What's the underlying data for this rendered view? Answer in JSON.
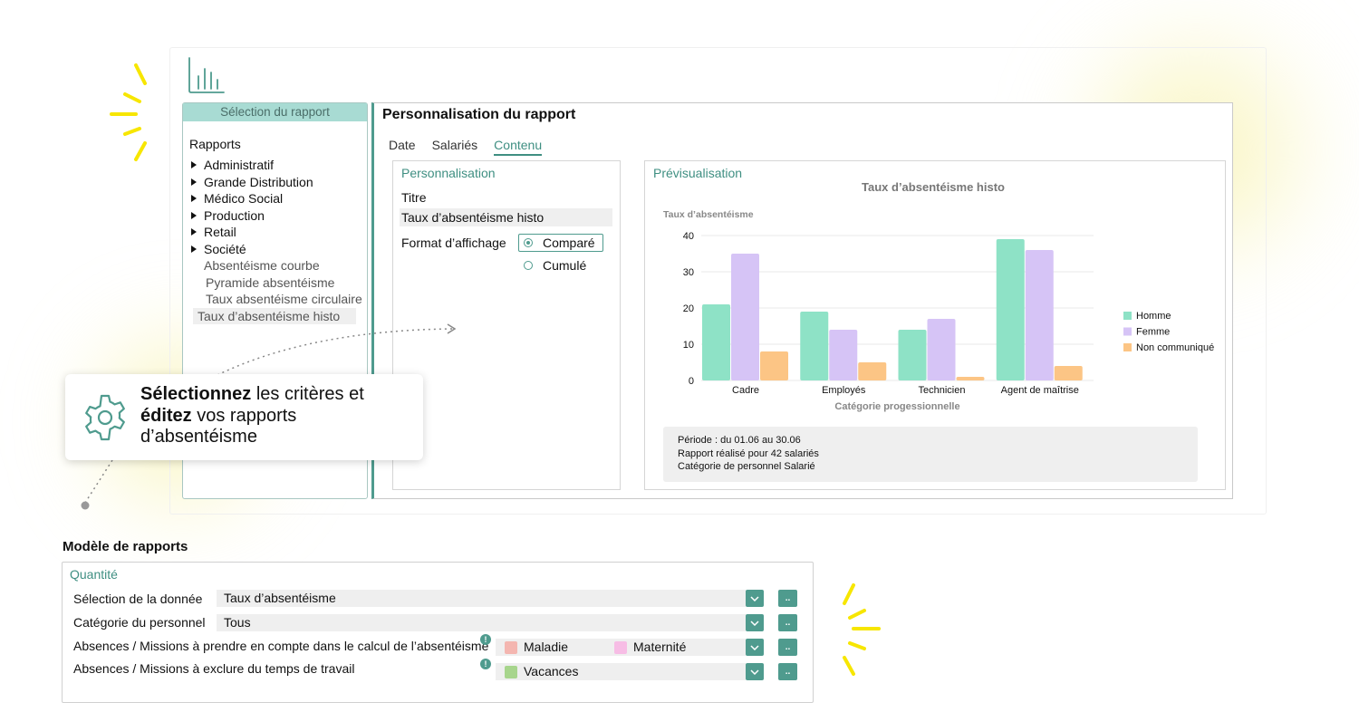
{
  "sidebar": {
    "header": "Sélection du rapport",
    "section": "Rapports",
    "folders": [
      "Administratif",
      "Grande Distribution",
      "Médico Social",
      "Production",
      "Retail",
      "Société"
    ],
    "reports": [
      "Absentéisme courbe",
      "Pyramide absentéisme",
      "Taux absentéisme circulaire",
      "Taux d’absentéisme histo"
    ]
  },
  "main": {
    "title": "Personnalisation du rapport",
    "tabs": [
      "Date",
      "Salariés",
      "Contenu"
    ],
    "active_tab": "Contenu",
    "personalisation": {
      "title": "Personnalisation",
      "titre_label": "Titre",
      "titre_value": "Taux d’absentéisme histo",
      "format_label": "Format d’affichage",
      "options": [
        "Comparé",
        "Cumulé"
      ],
      "selected_option": "Comparé"
    },
    "preview": {
      "title": "Prévisualisation",
      "info_lines": [
        "Période : du 01.06 au 30.06",
        "Rapport réalisé pour 42 salariés",
        "Catégorie de personnel Salarié"
      ]
    }
  },
  "chart_data": {
    "type": "bar",
    "title": "Taux d’absentéisme histo",
    "xlabel": "Catégorie progessionnelle",
    "ylabel": "Taux d’absentéisme",
    "categories": [
      "Cadre",
      "Employés",
      "Technicien",
      "Agent de maîtrise"
    ],
    "series": [
      {
        "name": "Homme",
        "values": [
          21,
          19,
          14,
          39
        ],
        "color": "#8ee2c6"
      },
      {
        "name": "Femme",
        "values": [
          35,
          14,
          17,
          36
        ],
        "color": "#d6c4f6"
      },
      {
        "name": "Non communiqué",
        "values": [
          8,
          5,
          1,
          4
        ],
        "color": "#fcc585"
      }
    ],
    "ylim": [
      0,
      40
    ],
    "yticks": [
      0,
      10,
      20,
      30,
      40
    ],
    "grid": true,
    "legend": "right"
  },
  "callout": {
    "bold1": "Sélectionnez",
    "text1": " les critères et ",
    "bold2": "éditez",
    "text2": " vos rapports d’absentéisme"
  },
  "models": {
    "title": "Modèle de rapports",
    "box_title": "Quantité",
    "rows": [
      {
        "label": "Sélection de la donnée",
        "value": "Taux d’absentéisme"
      },
      {
        "label": "Catégorie du personnel",
        "value": "Tous"
      },
      {
        "label": "Absences / Missions à prendre en compte dans le calcul de l’absentéisme",
        "chips": [
          {
            "text": "Maladie",
            "color": "#f4b6b0"
          },
          {
            "text": "Maternité",
            "color": "#f7bde5"
          }
        ]
      },
      {
        "label": "Absences / Missions à exclure du temps de travail",
        "chips": [
          {
            "text": "Vacances",
            "color": "#a7d58c"
          }
        ]
      }
    ],
    "more_label": ".."
  },
  "colors": {
    "accent": "#4f9b8e",
    "sidebar_header": "#a8dbd3",
    "sparkle": "#f7e600"
  }
}
